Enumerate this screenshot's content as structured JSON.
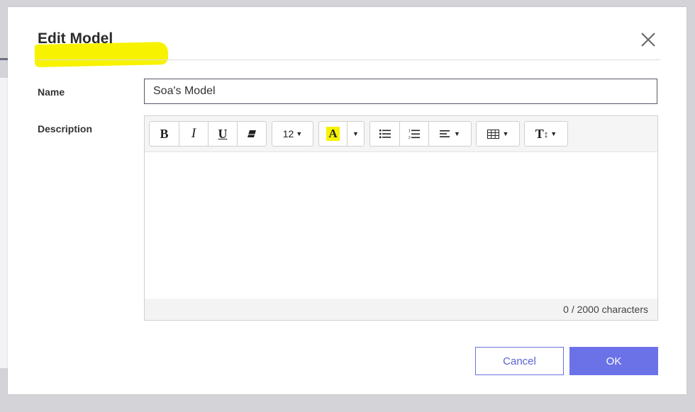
{
  "dialog": {
    "title": "Edit Model"
  },
  "form": {
    "name_label": "Name",
    "name_value": "Soa's Model",
    "description_label": "Description"
  },
  "toolbar": {
    "bold": "B",
    "italic": "I",
    "underline": "U",
    "font_size": "12",
    "highlight_letter": "A",
    "style_letter": "T"
  },
  "editor": {
    "char_count": "0 / 2000 characters"
  },
  "footer": {
    "cancel_label": "Cancel",
    "ok_label": "OK"
  },
  "colors": {
    "primary": "#6b72e8",
    "highlight": "#f7f200"
  },
  "icons": {
    "close": "close-icon",
    "eraser": "eraser-icon",
    "bulleted_list": "bulleted-list-icon",
    "numbered_list": "numbered-list-icon",
    "align": "align-left-icon",
    "table": "table-icon",
    "text_style": "text-size-icon"
  }
}
